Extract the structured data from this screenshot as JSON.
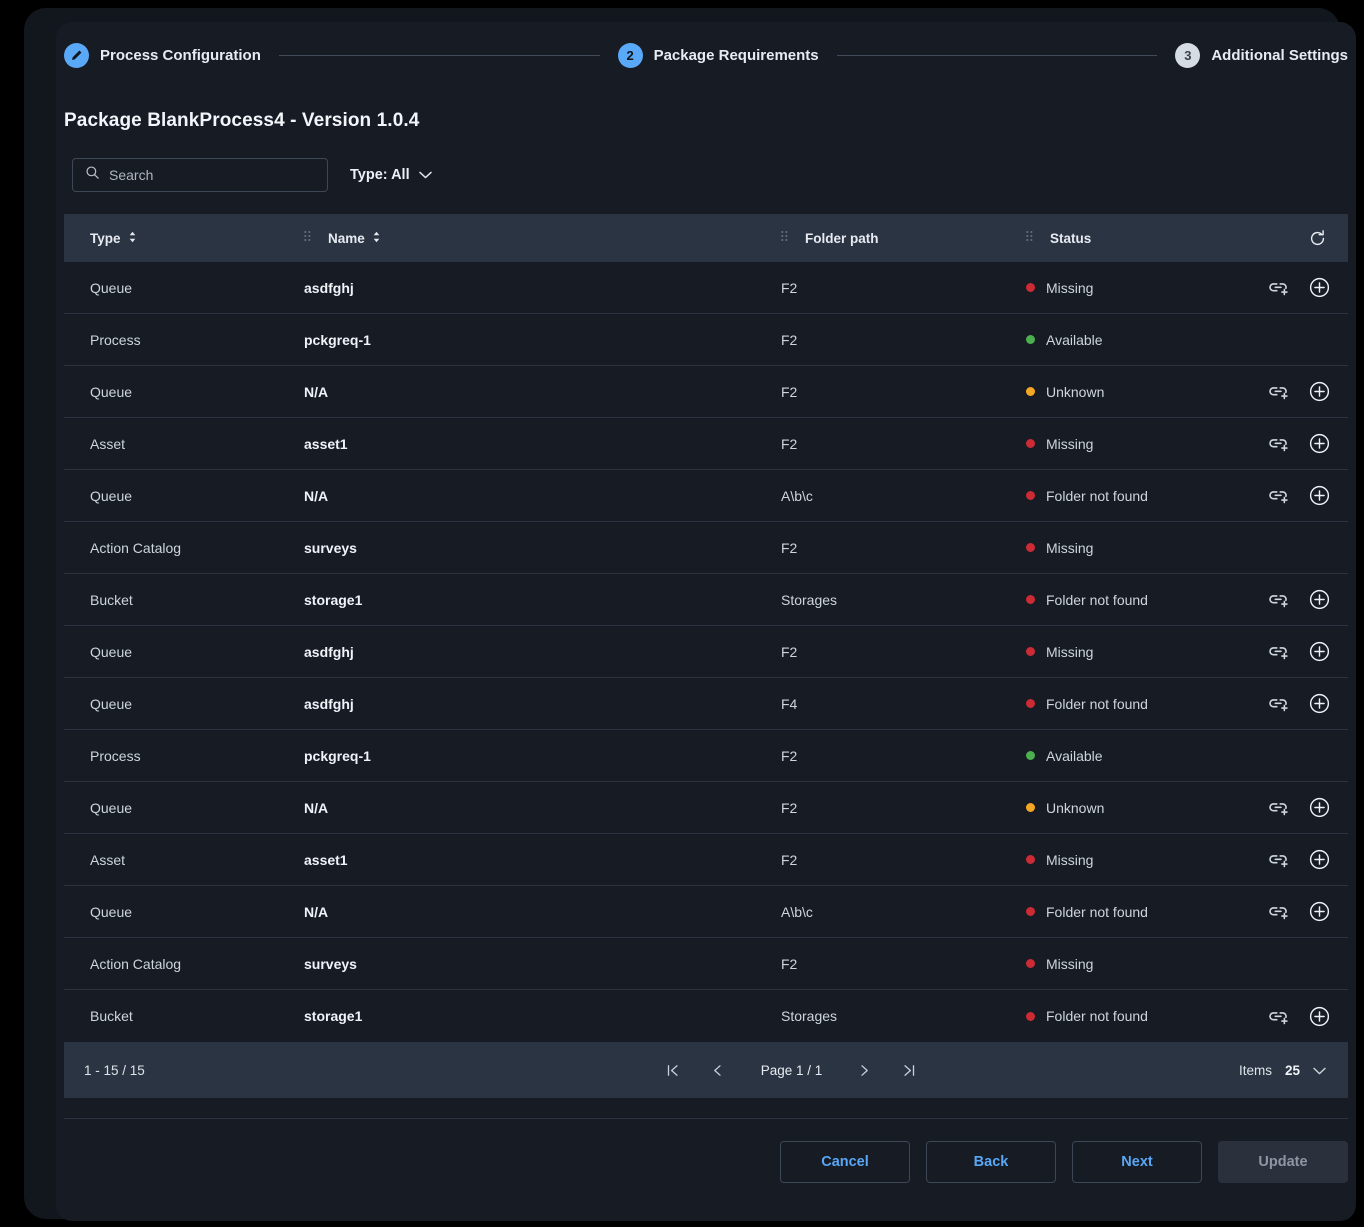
{
  "stepper": {
    "steps": [
      {
        "num": "1",
        "label": "Process Configuration",
        "state": "done",
        "icon": "pencil-icon"
      },
      {
        "num": "2",
        "label": "Package Requirements",
        "state": "active",
        "icon": "number"
      },
      {
        "num": "3",
        "label": "Additional Settings",
        "state": "pending",
        "icon": "number"
      }
    ]
  },
  "page": {
    "title": "Package BlankProcess4 - Version 1.0.4"
  },
  "filters": {
    "search_placeholder": "Search",
    "search_value": "",
    "search_icon": "search-icon",
    "type_label": "Type: All",
    "type_chevron": "chevron-down-icon"
  },
  "table": {
    "columns": [
      {
        "key": "type",
        "label": "Type",
        "sortable": true,
        "grip": false
      },
      {
        "key": "name",
        "label": "Name",
        "sortable": true,
        "grip": true
      },
      {
        "key": "folder",
        "label": "Folder path",
        "sortable": false,
        "grip": true
      },
      {
        "key": "status",
        "label": "Status",
        "sortable": false,
        "grip": true
      }
    ],
    "refresh_icon": "refresh-icon",
    "row_actions": [
      {
        "icon": "link-plus-icon",
        "name": "link-existing-button"
      },
      {
        "icon": "plus-circle-icon",
        "name": "create-new-button"
      }
    ],
    "status_colors": {
      "Missing": "#cc2b35",
      "Available": "#4caf50",
      "Unknown": "#f5a623",
      "Folder not found": "#cc2b35"
    },
    "rows": [
      {
        "type": "Queue",
        "name": "asdfghj",
        "folder": "F2",
        "status": "Missing",
        "actions": true
      },
      {
        "type": "Process",
        "name": "pckgreq-1",
        "folder": "F2",
        "status": "Available",
        "actions": false
      },
      {
        "type": "Queue",
        "name": "N/A",
        "folder": "F2",
        "status": "Unknown",
        "actions": true
      },
      {
        "type": "Asset",
        "name": "asset1",
        "folder": "F2",
        "status": "Missing",
        "actions": true
      },
      {
        "type": "Queue",
        "name": "N/A",
        "folder": "A\\b\\c",
        "status": "Folder not found",
        "actions": true
      },
      {
        "type": "Action Catalog",
        "name": "surveys",
        "folder": "F2",
        "status": "Missing",
        "actions": false
      },
      {
        "type": "Bucket",
        "name": "storage1",
        "folder": "Storages",
        "status": "Folder not found",
        "actions": true
      },
      {
        "type": "Queue",
        "name": "asdfghj",
        "folder": "F2",
        "status": "Missing",
        "actions": true
      },
      {
        "type": "Queue",
        "name": "asdfghj",
        "folder": "F4",
        "status": "Folder not found",
        "actions": true
      },
      {
        "type": "Process",
        "name": "pckgreq-1",
        "folder": "F2",
        "status": "Available",
        "actions": false
      },
      {
        "type": "Queue",
        "name": "N/A",
        "folder": "F2",
        "status": "Unknown",
        "actions": true
      },
      {
        "type": "Asset",
        "name": "asset1",
        "folder": "F2",
        "status": "Missing",
        "actions": true
      },
      {
        "type": "Queue",
        "name": "N/A",
        "folder": "A\\b\\c",
        "status": "Folder not found",
        "actions": true
      },
      {
        "type": "Action Catalog",
        "name": "surveys",
        "folder": "F2",
        "status": "Missing",
        "actions": false
      },
      {
        "type": "Bucket",
        "name": "storage1",
        "folder": "Storages",
        "status": "Folder not found",
        "actions": true
      }
    ]
  },
  "pagination": {
    "range": "1 - 15 / 15",
    "first_icon": "first-page-icon",
    "prev_icon": "previous-page-icon",
    "page_label": "Page 1 / 1",
    "next_icon": "next-page-icon",
    "last_icon": "last-page-icon",
    "items_label": "Items",
    "items_value": "25",
    "items_chevron": "chevron-down-icon"
  },
  "footer_buttons": [
    {
      "label": "Cancel",
      "style": "outline",
      "name": "cancel-button"
    },
    {
      "label": "Back",
      "style": "outline",
      "name": "back-button"
    },
    {
      "label": "Next",
      "style": "outline",
      "name": "next-button"
    },
    {
      "label": "Update",
      "style": "disabled",
      "name": "update-button"
    }
  ]
}
